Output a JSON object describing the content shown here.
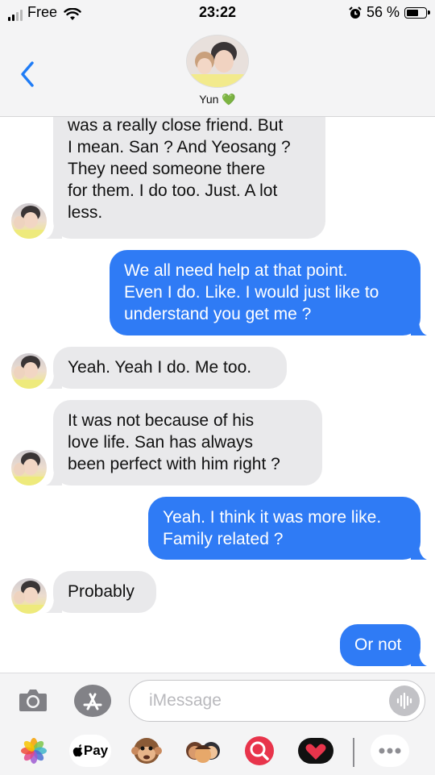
{
  "status": {
    "carrier": "Free",
    "time": "23:22",
    "battery_label": "56 %"
  },
  "header": {
    "contact_name": "Yun",
    "heart_emoji": "💚",
    "back_icon": "chevron-left-icon"
  },
  "messages": [
    {
      "from": "contact",
      "lines": [
        "was a really close friend. But",
        "I mean. San ? And Yeosang ?",
        "They need someone there",
        "for them. I do too. Just. A lot",
        "less."
      ]
    },
    {
      "from": "me",
      "lines": [
        "We all need help at that point.",
        "Even I do. Like. I would just like to",
        "understand you get me ?"
      ]
    },
    {
      "from": "contact",
      "lines": [
        "Yeah. Yeah I do. Me too."
      ]
    },
    {
      "from": "contact",
      "lines": [
        "It was not because of his",
        "love life. San has always",
        "been perfect with him right ?"
      ]
    },
    {
      "from": "me",
      "lines": [
        "Yeah. I think it was more like.",
        "Family related ?"
      ]
    },
    {
      "from": "contact",
      "lines": [
        "Probably"
      ]
    },
    {
      "from": "me",
      "lines": [
        "Or not"
      ]
    }
  ],
  "composer": {
    "placeholder": "iMessage",
    "camera_icon": "camera-icon",
    "apps_icon": "app-store-icon",
    "audio_icon": "audio-waveform-icon"
  },
  "app_drawer": {
    "items": [
      {
        "name": "photos-app-icon"
      },
      {
        "name": "apple-pay-app-icon",
        "label": "Pay"
      },
      {
        "name": "animoji-app-icon"
      },
      {
        "name": "memoji-app-icon"
      },
      {
        "name": "image-search-app-icon"
      },
      {
        "name": "digital-touch-app-icon"
      },
      {
        "name": "more-apps-icon"
      }
    ]
  },
  "colors": {
    "outgoing_bubble": "#2f7bf5",
    "incoming_bubble": "#e9e9eb",
    "accent": "#007aff"
  }
}
